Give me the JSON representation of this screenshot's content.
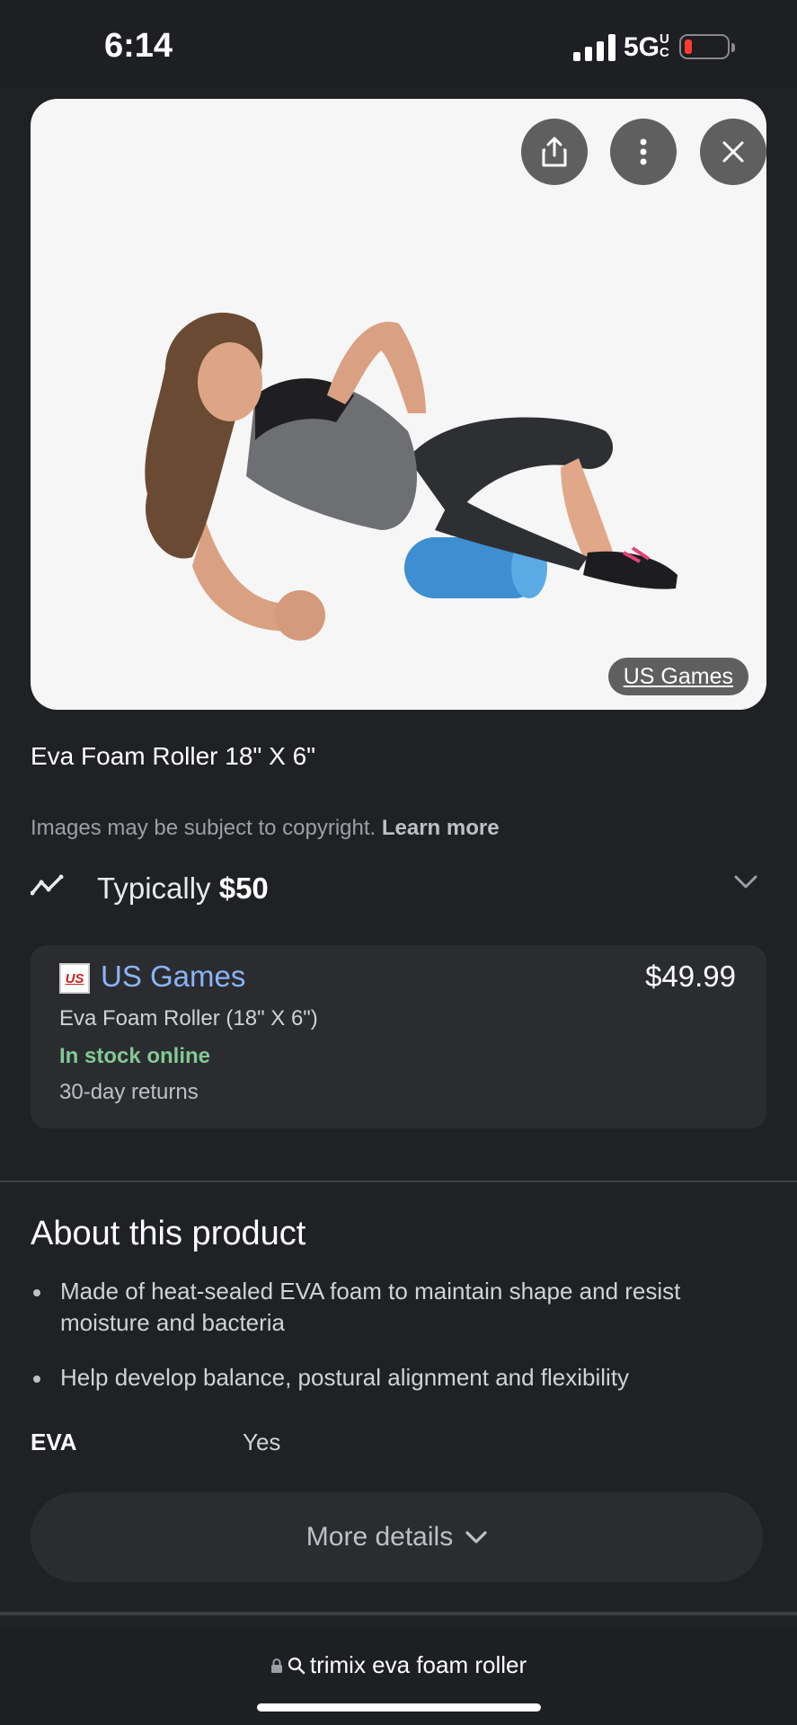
{
  "status_bar": {
    "time": "6:14",
    "network": "5GUC",
    "battery_color": "#ff3b30"
  },
  "image_viewer": {
    "image_description_icon": "product-photo",
    "buttons": {
      "share": "share-icon",
      "more": "more-vert-icon",
      "close": "close-icon"
    },
    "source_chip": "US Games"
  },
  "product": {
    "title": "Eva Foam Roller 18\" X 6\"",
    "copyright_text": "Images may be subject to copyright.",
    "learn_more": "Learn more",
    "price_prefix": "Typically",
    "typical_price": "$50"
  },
  "offer": {
    "store": "US Games",
    "logo_text": "US",
    "price": "$49.99",
    "description": "Eva Foam Roller (18\" X 6\")",
    "availability": "In stock online",
    "returns": "30-day returns"
  },
  "about": {
    "heading": "About this product",
    "bullets": [
      "Made of heat-sealed EVA foam to maintain shape and resist moisture and bacteria",
      "Help develop balance, postural alignment and flexibility"
    ],
    "attributes": [
      {
        "label": "EVA",
        "value": "Yes"
      }
    ],
    "more_details": "More details"
  },
  "address_bar": {
    "query": "trimix eva foam roller"
  },
  "colors": {
    "link": "#8ab4f8",
    "stock": "#81c995",
    "background": "#202124"
  }
}
